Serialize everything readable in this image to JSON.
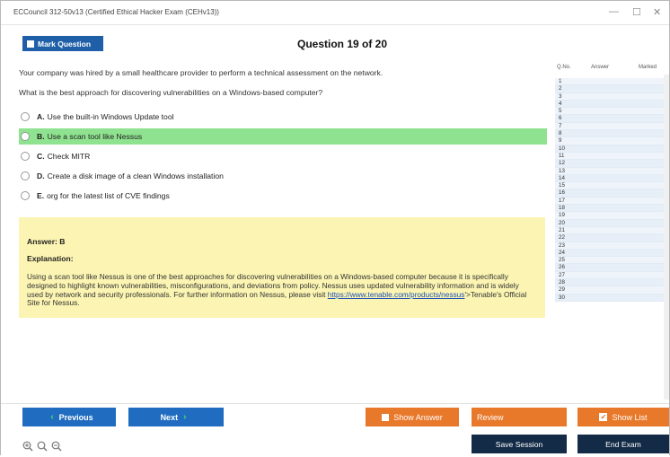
{
  "window": {
    "title": "ECCouncil 312-50v13 (Certified Ethical Hacker Exam (CEHv13))",
    "controls": [
      "—",
      "☐",
      "✕"
    ]
  },
  "toolbar": {
    "mark_label": "Mark Question",
    "question_title": "Question 19 of 20"
  },
  "question": {
    "line1": "Your company was hired by a small healthcare provider to perform a technical assessment on the network.",
    "line2": "What is the best approach for discovering vulnerabilities on a Windows-based computer?"
  },
  "options": [
    {
      "letter": "A.",
      "text": "Use the built-in Windows Update tool",
      "selected": false
    },
    {
      "letter": "B.",
      "text": "Use a scan tool like Nessus",
      "selected": true
    },
    {
      "letter": "C.",
      "text": "Check MITR",
      "selected": false
    },
    {
      "letter": "D.",
      "text": "Create a disk image of a clean Windows installation",
      "selected": false
    },
    {
      "letter": "E.",
      "text": "org for the latest list of CVE findings",
      "selected": false
    }
  ],
  "answer": {
    "answer_label": "Answer: B",
    "explanation_label": "Explanation:",
    "explanation_pre": "Using a scan tool like Nessus is one of the best approaches for discovering vulnerabilities on a Windows-based computer because it is specifically designed to highlight known vulnerabilities, misconfigurations, and deviations from policy. Nessus uses updated vulnerability information and is widely used by network and security professionals. For further information on Nessus, please visit ",
    "explanation_link": "https://www.tenable.com/products/nessus",
    "explanation_post": "'>Tenable's Official Site for Nessus."
  },
  "question_list": {
    "headers": {
      "no": "Q.No.",
      "answer": "Answer",
      "marked": "Marked"
    },
    "numbers": [
      "1",
      "2",
      "3",
      "4",
      "5",
      "6",
      "7",
      "8",
      "9",
      "10",
      "11",
      "12",
      "13",
      "14",
      "15",
      "16",
      "17",
      "18",
      "19",
      "20",
      "21",
      "22",
      "23",
      "24",
      "25",
      "26",
      "27",
      "28",
      "29",
      "30"
    ]
  },
  "buttons": {
    "previous": "Previous",
    "next": "Next",
    "show_answer": "Show Answer",
    "review": "Review",
    "show_list": "Show List",
    "save_session": "Save Session",
    "end_exam": "End Exam"
  },
  "colors": {
    "primary_blue": "#1f6cc0",
    "orange": "#e8782a",
    "dark_navy": "#142b47",
    "selected_green": "#8fe28f",
    "answer_yellow": "#fbf4b2"
  }
}
